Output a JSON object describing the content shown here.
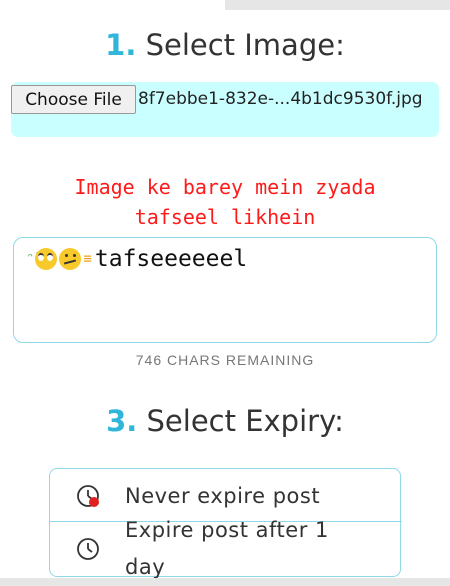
{
  "step1": {
    "number": "1.",
    "title": "Select Image:"
  },
  "file": {
    "button_label": "Choose File",
    "file_name": "8f7ebbe1-832e-...4b1dc9530f.jpg"
  },
  "description": {
    "prompt_line1": "Image ke barey mein zyada",
    "prompt_line2": "tafseel likhein",
    "value": "tafseeeeeel",
    "emoji_icons": [
      "dizzy-face-emoji",
      "eye-roll-emoji",
      "confused-emoji",
      "grimace-emoji"
    ],
    "chars_remaining": "746 CHARS REMAINING"
  },
  "step3": {
    "number": "3.",
    "title": "Select Expiry:"
  },
  "expiry": {
    "options": [
      {
        "label": "Never expire post",
        "icon": "clock-icon",
        "selected": true
      },
      {
        "label": "Expire post after 1 day",
        "icon": "clock-icon",
        "selected": false
      }
    ]
  },
  "colors": {
    "accent": "#2fb6d8",
    "prompt_red": "#ff1a1a",
    "file_bg": "#caffff",
    "border": "#8fd8e8"
  }
}
